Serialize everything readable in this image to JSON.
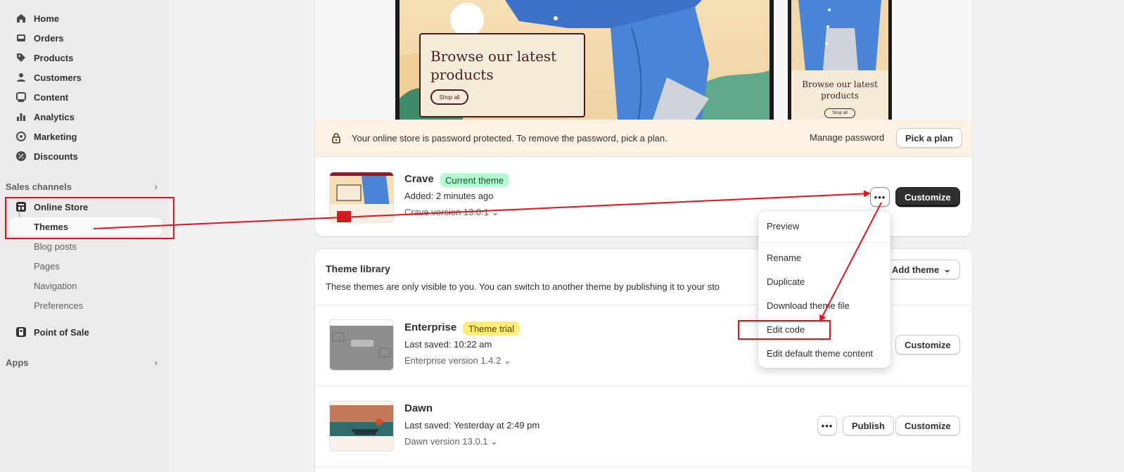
{
  "sidebar": {
    "items": [
      {
        "label": "Home",
        "icon": "home-icon"
      },
      {
        "label": "Orders",
        "icon": "inbox-icon"
      },
      {
        "label": "Products",
        "icon": "tag-icon"
      },
      {
        "label": "Customers",
        "icon": "person-icon"
      },
      {
        "label": "Content",
        "icon": "image-icon"
      },
      {
        "label": "Analytics",
        "icon": "chart-bar-icon"
      },
      {
        "label": "Marketing",
        "icon": "target-icon"
      },
      {
        "label": "Discounts",
        "icon": "discount-icon"
      }
    ],
    "sales_channels": "Sales channels",
    "online_store": "Online Store",
    "sub_items": [
      "Themes",
      "Blog posts",
      "Pages",
      "Navigation",
      "Preferences"
    ],
    "point_of_sale": "Point of Sale",
    "apps": "Apps"
  },
  "preview": {
    "tablet_headline": "Browse our latest products",
    "tablet_button": "Shop all",
    "phone_headline": "Browse our latest products",
    "phone_button": "Shop all"
  },
  "banner": {
    "text": "Your online store is password protected. To remove the password, pick a plan.",
    "manage": "Manage password",
    "pick_plan": "Pick a plan"
  },
  "current_theme": {
    "name": "Crave",
    "badge": "Current theme",
    "added": "Added: 2 minutes ago",
    "version": "Crave version 13.0.1",
    "customize": "Customize"
  },
  "menu": {
    "items": [
      "Preview",
      "Rename",
      "Duplicate",
      "Download theme file",
      "Edit code",
      "Edit default theme content"
    ]
  },
  "library": {
    "title": "Theme library",
    "description": "These themes are only visible to you. You can switch to another theme by publishing it to your sto",
    "add_theme": "Add theme",
    "themes": [
      {
        "name": "Enterprise",
        "badge": "Theme trial",
        "saved": "Last saved: 10:22 am",
        "version": "Enterprise version 1.4.2",
        "customize": "Customize"
      },
      {
        "name": "Dawn",
        "badge": "",
        "saved": "Last saved: Yesterday at 2:49 pm",
        "version": "Dawn version 13.0.1",
        "publish": "Publish",
        "customize": "Customize"
      }
    ]
  },
  "colors": {
    "highlight": "#e8101a",
    "current_badge": "#b4fed2",
    "trial_badge": "#ffeb78",
    "banner": "#fff1e3"
  }
}
